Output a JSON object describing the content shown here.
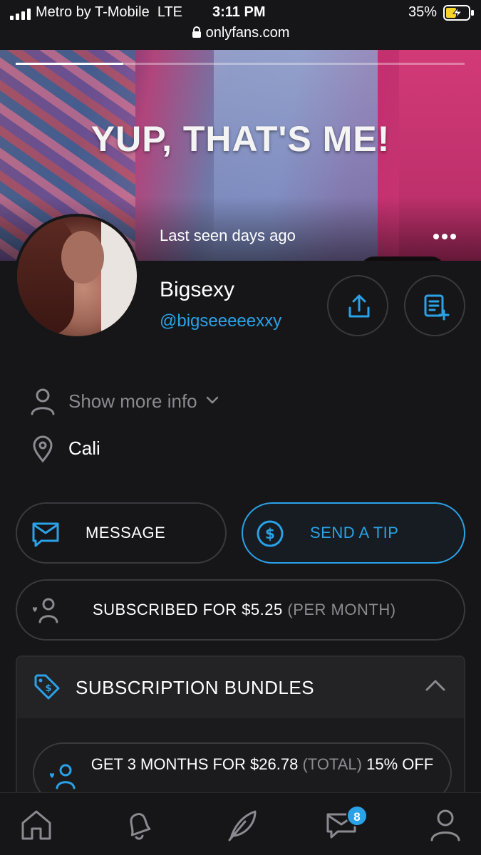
{
  "status_bar": {
    "carrier": "Metro by T-Mobile",
    "network": "LTE",
    "time": "3:11 PM",
    "battery_percent": "35%",
    "url": "onlyfans.com"
  },
  "cover": {
    "title_text": "YUP, THAT'S ME!",
    "last_seen": "Last seen days ago",
    "story_progress": 0.24
  },
  "profile": {
    "name": "Bigsexy",
    "handle": "@bigseeeeexxy",
    "show_more_label": "Show more info",
    "location": "Cali"
  },
  "actions": {
    "message_label": "MESSAGE",
    "tip_label": "SEND A TIP",
    "subscribed_label": "SUBSCRIBED FOR $5.25",
    "subscribed_period": "(PER MONTH)"
  },
  "bundles": {
    "title": "SUBSCRIPTION BUNDLES",
    "items": [
      {
        "label_a": "GET 3 MONTHS FOR $26.78",
        "label_total": "(TOTAL)",
        "label_b": "15% OFF"
      }
    ]
  },
  "bottom_nav": {
    "items": [
      "home",
      "notifications",
      "new-post",
      "messages",
      "profile"
    ],
    "messages_badge": "8"
  },
  "colors": {
    "accent": "#2aa2e8",
    "background": "#161618",
    "border": "#3a3a3e",
    "muted": "#8a8a90"
  }
}
